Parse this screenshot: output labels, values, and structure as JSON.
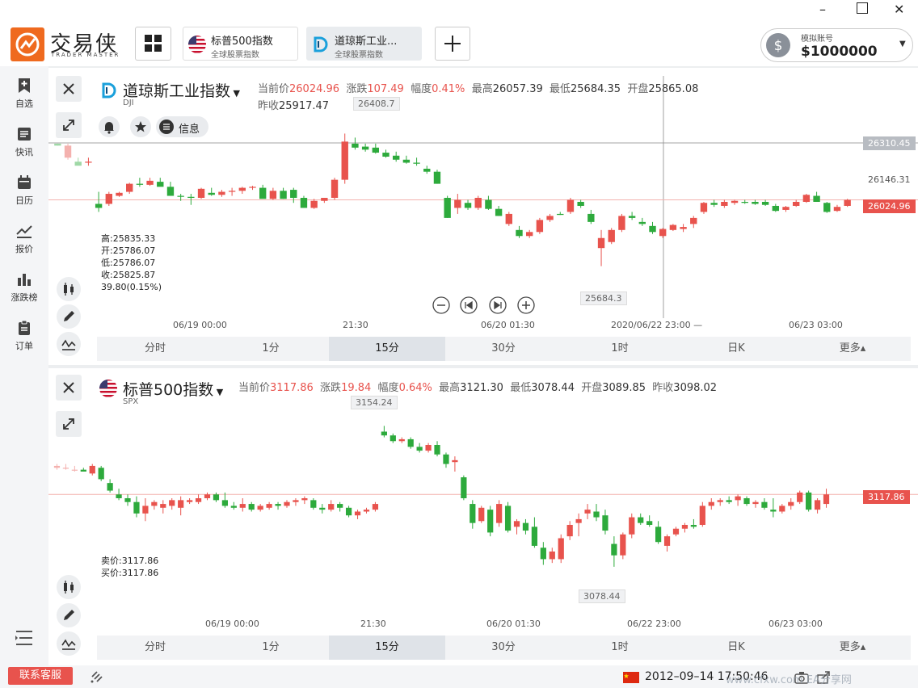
{
  "app": {
    "logo_text": "交易侠",
    "logo_sub": "TRADER MASTER",
    "tabs": [
      {
        "title": "标普500指数",
        "subtitle": "全球股票指数",
        "icon": "us-flag-icon"
      },
      {
        "title": "道琼斯工业...",
        "subtitle": "全球股票指数",
        "icon": "dji-logo-icon"
      }
    ],
    "account": {
      "label": "模拟账号",
      "balance": "$1000000"
    }
  },
  "sidebar": [
    {
      "label": "自选",
      "icon": "bookmark-add-icon"
    },
    {
      "label": "快讯",
      "icon": "news-icon"
    },
    {
      "label": "日历",
      "icon": "calendar-icon"
    },
    {
      "label": "报价",
      "icon": "line-chart-icon"
    },
    {
      "label": "涨跌榜",
      "icon": "bar-chart-icon"
    },
    {
      "label": "订单",
      "icon": "clipboard-icon"
    }
  ],
  "dji": {
    "name": "道琼斯工业指数",
    "code": "DJI",
    "current_label": "当前价",
    "current": "26024.96",
    "change_label": "涨跌",
    "change": "107.49",
    "pct_label": "幅度",
    "pct": "0.41%",
    "high_label": "最高",
    "high": "26057.39",
    "low_label": "最低",
    "low": "25684.35",
    "open_label": "开盘",
    "open": "25865.08",
    "prev_label": "昨收",
    "prev": "25917.47",
    "info_btn": "信息",
    "max_marker": "26408.7",
    "min_marker": "25684.3",
    "axis_tags": [
      "26310.45",
      "26146.31",
      "26024.96"
    ],
    "crosshair_time": "2020/06/22 23:00",
    "ohlc": [
      "高:25835.33",
      "开:25786.07",
      "低:25786.07",
      "收:25825.87",
      "39.80(0.15%)"
    ],
    "xticks": [
      "06/19 00:00",
      "21:30",
      "06/20 01:30",
      "06/23 03:00"
    ]
  },
  "spx": {
    "name": "标普500指数",
    "code": "SPX",
    "current_label": "当前价",
    "current": "3117.86",
    "change_label": "涨跌",
    "change": "19.84",
    "pct_label": "幅度",
    "pct": "0.64%",
    "high_label": "最高",
    "high": "3121.30",
    "low_label": "最低",
    "low": "3078.44",
    "open_label": "开盘",
    "open": "3089.85",
    "prev_label": "昨收",
    "prev": "3098.02",
    "max_marker": "3154.24",
    "min_marker": "3078.44",
    "price_tag": "3117.86",
    "quotes": [
      "卖价:3117.86",
      "买价:3117.86"
    ],
    "xticks": [
      "06/19 00:00",
      "21:30",
      "06/20 01:30",
      "06/22 23:00",
      "06/23 03:00"
    ]
  },
  "timeframes": [
    "分时",
    "1分",
    "15分",
    "30分",
    "1时",
    "日K",
    "更多▴"
  ],
  "active_timeframe": "15分",
  "status": {
    "support_button": "联系客服",
    "datetime": "2012–09–14 17:50:46",
    "watermark": "www.cfxw.com EA分享网"
  },
  "colors": {
    "up": "#e8534d",
    "down": "#2daa3c",
    "accent": "#ef6a1f"
  },
  "chart_data": [
    {
      "type": "candlestick",
      "series_ref": "DJI",
      "title": "道琼斯工业指数",
      "ylim": [
        25620,
        26420
      ],
      "candles": [
        [
          26300,
          26300,
          26290,
          26290
        ],
        [
          26230,
          26300,
          26220,
          26290
        ],
        [
          26210,
          26230,
          26200,
          26190
        ],
        [
          26205,
          26230,
          26190,
          26210
        ],
        [
          26000,
          26060,
          25960,
          25980
        ],
        [
          26000,
          26060,
          25990,
          26050
        ],
        [
          26040,
          26060,
          26035,
          26055
        ],
        [
          26060,
          26105,
          26050,
          26100
        ],
        [
          26100,
          26130,
          26085,
          26095
        ],
        [
          26095,
          26130,
          26090,
          26115
        ],
        [
          26110,
          26130,
          26100,
          26085
        ],
        [
          26085,
          26110,
          26040,
          26040
        ],
        [
          26040,
          26050,
          26015,
          26035
        ],
        [
          26035,
          26050,
          25995,
          26030
        ],
        [
          26030,
          26080,
          26025,
          26075
        ],
        [
          26055,
          26080,
          26040,
          26045
        ],
        [
          26045,
          26070,
          26035,
          26060
        ],
        [
          26060,
          26080,
          26040,
          26065
        ],
        [
          26065,
          26085,
          26050,
          26080
        ],
        [
          26080,
          26090,
          26070,
          26085
        ],
        [
          26080,
          26095,
          26050,
          26025
        ],
        [
          26025,
          26080,
          26020,
          26065
        ],
        [
          26065,
          26080,
          26025,
          26025
        ],
        [
          26070,
          26080,
          26005,
          26030
        ],
        [
          26030,
          26040,
          25980,
          25980
        ],
        [
          25980,
          26025,
          25975,
          26015
        ],
        [
          26015,
          26030,
          26005,
          26030
        ],
        [
          26030,
          26130,
          26020,
          26120
        ],
        [
          26120,
          26350,
          26100,
          26310
        ],
        [
          26300,
          26330,
          26270,
          26280
        ],
        [
          26285,
          26300,
          26260,
          26270
        ],
        [
          26280,
          26300,
          26250,
          26255
        ],
        [
          26255,
          26270,
          26230,
          26235
        ],
        [
          26240,
          26260,
          26210,
          26220
        ],
        [
          26220,
          26240,
          26200,
          26205
        ],
        [
          26205,
          26230,
          26190,
          26200
        ],
        [
          26175,
          26190,
          26150,
          26160
        ],
        [
          26160,
          26170,
          26100,
          26100
        ],
        [
          26030,
          26040,
          25930,
          25930
        ],
        [
          25980,
          26050,
          25950,
          26020
        ],
        [
          26005,
          26020,
          25970,
          25980
        ],
        [
          25980,
          26040,
          25970,
          26030
        ],
        [
          26020,
          26040,
          25970,
          25975
        ],
        [
          25975,
          25990,
          25940,
          25940
        ],
        [
          25900,
          25960,
          25890,
          25950
        ],
        [
          25870,
          25890,
          25830,
          25840
        ],
        [
          25840,
          25870,
          25830,
          25860
        ],
        [
          25860,
          25930,
          25850,
          25920
        ],
        [
          25920,
          25950,
          25910,
          25940
        ],
        [
          25950,
          25960,
          25945,
          25945
        ],
        [
          25960,
          26030,
          25950,
          26020
        ],
        [
          26010,
          26020,
          25980,
          25990
        ],
        [
          25950,
          25970,
          25900,
          25910
        ],
        [
          25780,
          25870,
          25690,
          25830
        ],
        [
          25810,
          25880,
          25800,
          25870
        ],
        [
          25870,
          25950,
          25860,
          25940
        ],
        [
          25940,
          25960,
          25920,
          25930
        ],
        [
          25910,
          25930,
          25890,
          25900
        ],
        [
          25890,
          25910,
          25850,
          25860
        ],
        [
          25840,
          25880,
          25830,
          25875
        ],
        [
          25870,
          25900,
          25865,
          25895
        ],
        [
          25875,
          25900,
          25860,
          25885
        ],
        [
          25900,
          25940,
          25880,
          25930
        ],
        [
          25960,
          26010,
          25950,
          26005
        ],
        [
          26005,
          26020,
          25985,
          25995
        ],
        [
          25990,
          26020,
          25980,
          26010
        ],
        [
          26005,
          26020,
          25995,
          26015
        ],
        [
          26010,
          26020,
          26000,
          26005
        ],
        [
          26010,
          26020,
          25995,
          26000
        ],
        [
          26010,
          26020,
          25990,
          25995
        ],
        [
          25990,
          26000,
          25960,
          25965
        ],
        [
          25970,
          25990,
          25960,
          25985
        ],
        [
          25990,
          26020,
          25985,
          26010
        ],
        [
          26010,
          26050,
          26005,
          26045
        ],
        [
          26040,
          26060,
          26010,
          26010
        ],
        [
          26005,
          26010,
          25955,
          25960
        ],
        [
          25965,
          25995,
          25960,
          25985
        ],
        [
          25990,
          26025,
          25985,
          26020
        ]
      ]
    },
    {
      "type": "candlestick",
      "series_ref": "SPX",
      "title": "标普500指数",
      "ylim": [
        3074,
        3158
      ],
      "candles": [
        [
          3132,
          3134,
          3131,
          3133
        ],
        [
          3132,
          3134,
          3131,
          3132
        ],
        [
          3131,
          3133,
          3130,
          3131
        ],
        [
          3131,
          3132,
          3130,
          3130
        ],
        [
          3129,
          3134,
          3128,
          3133
        ],
        [
          3132,
          3133,
          3125,
          3126
        ],
        [
          3124,
          3126,
          3119,
          3120
        ],
        [
          3118,
          3121,
          3115,
          3116
        ],
        [
          3116,
          3118,
          3112,
          3114
        ],
        [
          3114,
          3117,
          3106,
          3108
        ],
        [
          3108,
          3116,
          3104,
          3112
        ],
        [
          3112,
          3115,
          3110,
          3114
        ],
        [
          3111,
          3115,
          3108,
          3113
        ],
        [
          3112,
          3116,
          3110,
          3115
        ],
        [
          3111,
          3117,
          3107,
          3115
        ],
        [
          3114,
          3116,
          3113,
          3115
        ],
        [
          3114,
          3118,
          3113,
          3116
        ],
        [
          3116,
          3119,
          3115,
          3118
        ],
        [
          3118,
          3119,
          3114,
          3115
        ],
        [
          3115,
          3119,
          3111,
          3112
        ],
        [
          3112,
          3114,
          3110,
          3111
        ],
        [
          3111,
          3116,
          3109,
          3113
        ],
        [
          3113,
          3114,
          3109,
          3110
        ],
        [
          3110,
          3113,
          3109,
          3112
        ],
        [
          3111,
          3114,
          3110,
          3113
        ],
        [
          3113,
          3114,
          3110,
          3112
        ],
        [
          3112,
          3115,
          3111,
          3114
        ],
        [
          3114,
          3116,
          3112,
          3115
        ],
        [
          3115,
          3117,
          3113,
          3116
        ],
        [
          3115,
          3116,
          3110,
          3111
        ],
        [
          3111,
          3113,
          3108,
          3110
        ],
        [
          3110,
          3115,
          3109,
          3113
        ],
        [
          3113,
          3114,
          3109,
          3111
        ],
        [
          3111,
          3112,
          3106,
          3107
        ],
        [
          3107,
          3110,
          3105,
          3109
        ],
        [
          3109,
          3111,
          3108,
          3110
        ],
        [
          3110,
          3114,
          3109,
          3113
        ],
        [
          3151,
          3154,
          3148,
          3149
        ],
        [
          3149,
          3150,
          3145,
          3146
        ],
        [
          3146,
          3148,
          3145,
          3147
        ],
        [
          3147,
          3148,
          3142,
          3143
        ],
        [
          3143,
          3145,
          3140,
          3141
        ],
        [
          3141,
          3145,
          3140,
          3144
        ],
        [
          3144,
          3146,
          3138,
          3139
        ],
        [
          3139,
          3140,
          3132,
          3134
        ],
        [
          3135,
          3138,
          3130,
          3136
        ],
        [
          3127,
          3128,
          3115,
          3116
        ],
        [
          3113,
          3115,
          3100,
          3103
        ],
        [
          3104,
          3112,
          3103,
          3111
        ],
        [
          3110,
          3112,
          3096,
          3098
        ],
        [
          3103,
          3115,
          3101,
          3113
        ],
        [
          3112,
          3114,
          3098,
          3099
        ],
        [
          3101,
          3105,
          3097,
          3104
        ],
        [
          3103,
          3105,
          3097,
          3099
        ],
        [
          3101,
          3106,
          3090,
          3091
        ],
        [
          3090,
          3093,
          3081,
          3084
        ],
        [
          3084,
          3090,
          3082,
          3088
        ],
        [
          3084,
          3097,
          3082,
          3095
        ],
        [
          3096,
          3104,
          3094,
          3102
        ],
        [
          3103,
          3108,
          3096,
          3105
        ],
        [
          3108,
          3113,
          3105,
          3110
        ],
        [
          3109,
          3113,
          3104,
          3106
        ],
        [
          3107,
          3110,
          3097,
          3099
        ],
        [
          3092,
          3096,
          3080,
          3086
        ],
        [
          3086,
          3098,
          3084,
          3097
        ],
        [
          3097,
          3108,
          3095,
          3106
        ],
        [
          3106,
          3108,
          3102,
          3103
        ],
        [
          3104,
          3107,
          3101,
          3102
        ],
        [
          3101,
          3104,
          3092,
          3093
        ],
        [
          3091,
          3097,
          3088,
          3096
        ],
        [
          3097,
          3101,
          3096,
          3100
        ],
        [
          3100,
          3103,
          3098,
          3102
        ],
        [
          3102,
          3105,
          3100,
          3101
        ],
        [
          3102,
          3114,
          3101,
          3112
        ],
        [
          3112,
          3116,
          3110,
          3114
        ],
        [
          3114,
          3116,
          3112,
          3115
        ],
        [
          3115,
          3117,
          3113,
          3114
        ],
        [
          3115,
          3118,
          3112,
          3117
        ],
        [
          3116,
          3117,
          3112,
          3113
        ],
        [
          3113,
          3115,
          3111,
          3114
        ],
        [
          3114,
          3116,
          3110,
          3111
        ],
        [
          3110,
          3116,
          3106,
          3109
        ],
        [
          3109,
          3113,
          3108,
          3112
        ],
        [
          3112,
          3116,
          3110,
          3114
        ],
        [
          3114,
          3120,
          3113,
          3119
        ],
        [
          3119,
          3120,
          3109,
          3110
        ],
        [
          3110,
          3116,
          3108,
          3115
        ],
        [
          3113,
          3121,
          3111,
          3118
        ]
      ]
    }
  ]
}
